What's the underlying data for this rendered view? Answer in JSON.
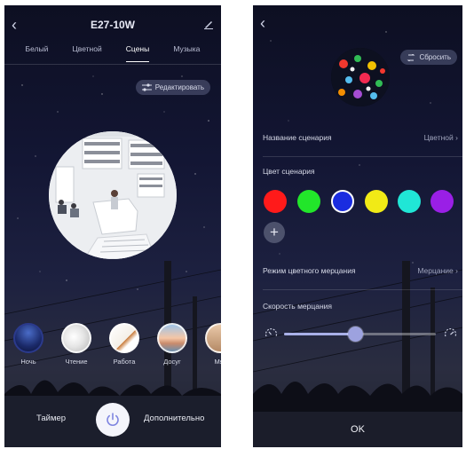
{
  "left": {
    "title": "E27-10W",
    "tabs": [
      {
        "label": "Белый",
        "active": false
      },
      {
        "label": "Цветной",
        "active": false
      },
      {
        "label": "Сцены",
        "active": true
      },
      {
        "label": "Музыка",
        "active": false
      }
    ],
    "edit_label": "Редактировать",
    "scenes": [
      {
        "label": "Ночь"
      },
      {
        "label": "Чтение"
      },
      {
        "label": "Работа"
      },
      {
        "label": "Досуг"
      },
      {
        "label": "Мяг"
      }
    ],
    "bottom": {
      "timer": "Таймер",
      "more": "Дополнительно"
    }
  },
  "right": {
    "reset_label": "Сбросить",
    "scene_name_label": "Название сценария",
    "scene_name_value": "Цветной",
    "scene_color_label": "Цвет сценария",
    "swatches": [
      "#ff1a1a",
      "#22e62a",
      "#1a2ce0",
      "#f1ea16",
      "#20e6d6",
      "#9a1fe6"
    ],
    "flicker_mode_label": "Режим цветного мерцания",
    "flicker_mode_value": "Мерцание",
    "speed_label": "Скорость мерцания",
    "speed_value": 0.47,
    "ok_label": "OK"
  }
}
